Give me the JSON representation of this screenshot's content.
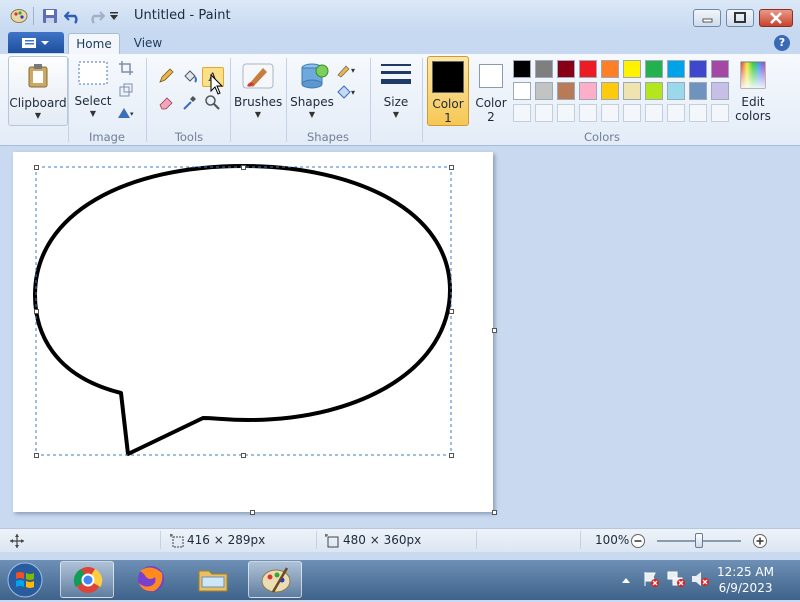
{
  "window": {
    "title": "Untitled - Paint"
  },
  "tabs": [
    {
      "label": "Home"
    },
    {
      "label": "View"
    }
  ],
  "help_label": "?",
  "ribbon": {
    "clipboard": {
      "label": "Clipboard",
      "group": ""
    },
    "image": {
      "select_label": "Select",
      "group": "Image"
    },
    "tools": {
      "group": "Tools"
    },
    "brushes": {
      "label": "Brushes"
    },
    "shapes": {
      "label": "Shapes",
      "group": "Shapes"
    },
    "size": {
      "label": "Size"
    },
    "color1": {
      "label_line1": "Color",
      "label_line2": "1",
      "value": "#000000"
    },
    "color2": {
      "label_line1": "Color",
      "label_line2": "2",
      "value": "#ffffff"
    },
    "colors": {
      "group": "Colors",
      "edit_line1": "Edit",
      "edit_line2": "colors"
    },
    "palette_row1": [
      "#000000",
      "#7f7f7f",
      "#880015",
      "#ed1c24",
      "#ff7f27",
      "#fff200",
      "#22b14c",
      "#00a2e8",
      "#3f48cc",
      "#a349a4"
    ],
    "palette_row2": [
      "#ffffff",
      "#c3c3c3",
      "#b97a57",
      "#ffaec9",
      "#ffc90e",
      "#efe4b0",
      "#b5e61d",
      "#99d9ea",
      "#7092be",
      "#c8bfe7"
    ]
  },
  "status": {
    "selection_size": "416 × 289px",
    "canvas_size": "480 × 360px",
    "zoom": "100%"
  },
  "taskbar": {
    "time": "12:25 AM",
    "date": "6/9/2023"
  }
}
